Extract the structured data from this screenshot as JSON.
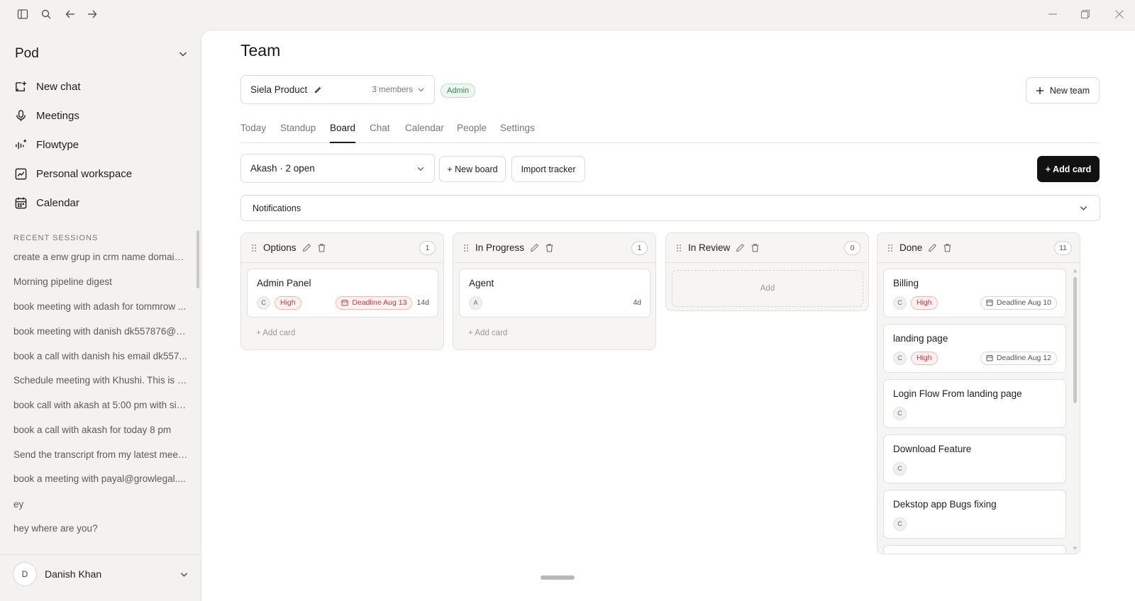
{
  "workspace": {
    "name": "Pod"
  },
  "nav": [
    {
      "label": "New chat",
      "icon": "new-chat-icon"
    },
    {
      "label": "Meetings",
      "icon": "microphone-icon"
    },
    {
      "label": "Flowtype",
      "icon": "waveform-sparkle-icon"
    },
    {
      "label": "Personal workspace",
      "icon": "chart-square-icon"
    },
    {
      "label": "Calendar",
      "icon": "calendar-icon"
    }
  ],
  "recent": {
    "label": "RECENT SESSIONS",
    "sessions": [
      "create a enw grup in crm name domain ...",
      "Morning pipeline digest",
      "book meeting with adash for tommrow ...",
      "book meeting with danish dk557876@g...",
      "book a call with danish his email dk557...",
      "Schedule meeting with Khushi. This is h...",
      "book call with akash at 5:00 pm with sie...",
      "book a call with akash for today 8 pm",
      "Send the transcript from my latest meet...",
      "book a meeting with payal@growlegal....",
      "ey",
      "hey where are you?"
    ]
  },
  "user": {
    "initial": "D",
    "name": "Danish Khan"
  },
  "page": {
    "title": "Team"
  },
  "team": {
    "name": "Siela Product",
    "members": "3 members",
    "role": "Admin",
    "new_team_label": "New team"
  },
  "tabs": [
    "Today",
    "Standup",
    "Board",
    "Chat",
    "Calendar",
    "People",
    "Settings"
  ],
  "board": {
    "selector": "Akash · 2 open",
    "new_board_label": "+ New board",
    "import_label": "Import tracker",
    "add_card_label": "+ Add card",
    "notifications_label": "Notifications",
    "add_card_inline": "+ Add card",
    "add_zone_label": "Add"
  },
  "columns": [
    {
      "title": "Options",
      "count": "1",
      "cards": [
        {
          "title": "Admin Panel",
          "assignee": "C",
          "priority": "High",
          "deadline": "Deadline Aug 13",
          "days": "14d"
        }
      ]
    },
    {
      "title": "In Progress",
      "count": "1",
      "cards": [
        {
          "title": "Agent",
          "assignee": "A",
          "days": "4d"
        }
      ]
    },
    {
      "title": "In Review",
      "count": "0",
      "cards": []
    },
    {
      "title": "Done",
      "count": "11",
      "cards": [
        {
          "title": "Billing",
          "assignee": "C",
          "priority": "High",
          "deadline": "Deadline Aug 10"
        },
        {
          "title": "landing page",
          "assignee": "C",
          "priority": "High",
          "deadline": "Deadline Aug 12"
        },
        {
          "title": "Login Flow From landing page",
          "assignee": "C"
        },
        {
          "title": "Download Feature",
          "assignee": "C"
        },
        {
          "title": "Dekstop app Bugs fixing",
          "assignee": "C"
        }
      ]
    }
  ],
  "colors": {
    "accent_dark": "#111111",
    "priority_red": "#c43a3a",
    "admin_green": "#2f8a4c"
  }
}
